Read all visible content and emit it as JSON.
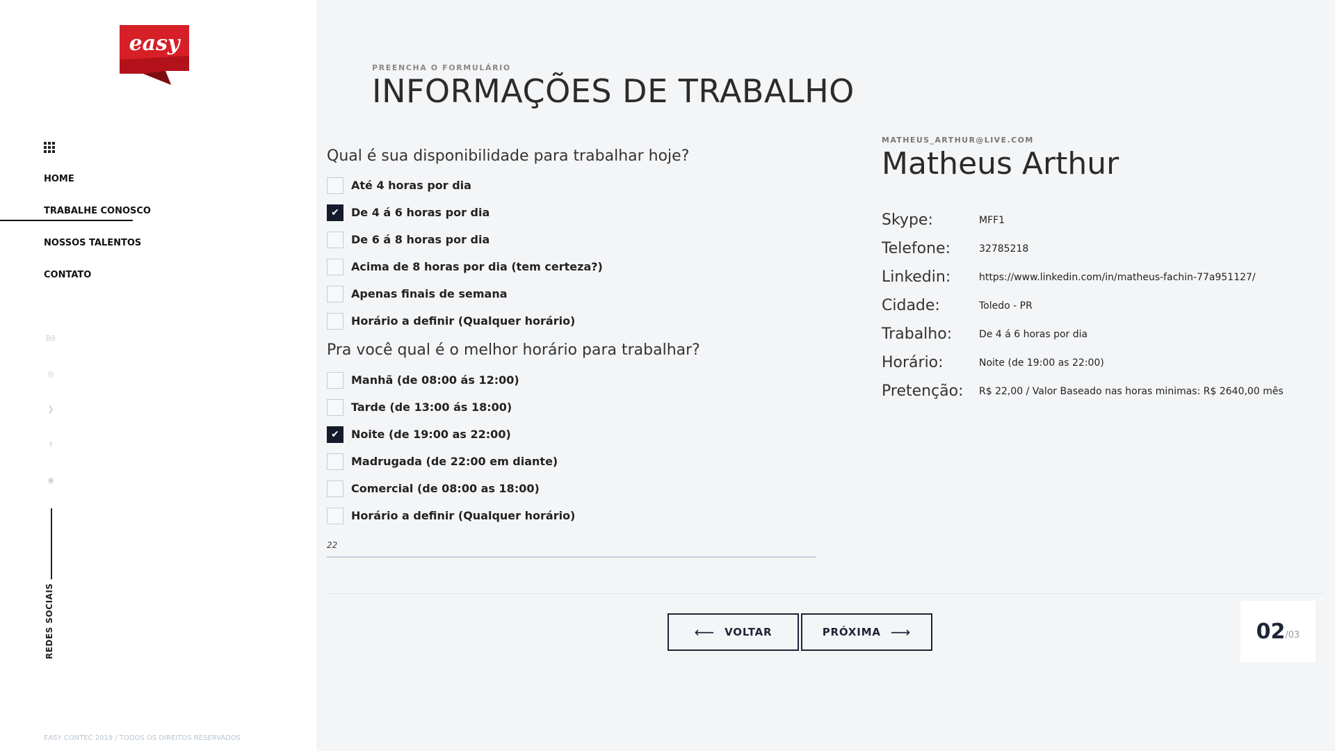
{
  "brand": {
    "logo_text": "easy",
    "logo_color": "#c9161f"
  },
  "nav": {
    "items": [
      {
        "label": "HOME"
      },
      {
        "label": "TRABALHE CONOSCO",
        "active": true
      },
      {
        "label": "NOSSOS TALENTOS"
      },
      {
        "label": "CONTATO"
      }
    ]
  },
  "social": {
    "icons": [
      "behance-icon",
      "dribbble-icon",
      "twitter-icon",
      "facebook-icon",
      "instagram-icon"
    ],
    "label": "REDES SOCIAIS"
  },
  "footer": {
    "text": "EASY CONTEC 2019 / TODOS OS DIREITOS RESERVADOS"
  },
  "header": {
    "pre_title": "PREENCHA O FORMULÁRIO",
    "title": "INFORMAÇÕES DE TRABALHO"
  },
  "form": {
    "q1": {
      "question": "Qual é sua disponibilidade para trabalhar hoje?",
      "options": [
        {
          "label": "Até 4 horas por dia",
          "checked": false
        },
        {
          "label": "De 4 á 6 horas por dia",
          "checked": true
        },
        {
          "label": "De 6 á 8 horas por dia",
          "checked": false
        },
        {
          "label": "Acima de 8 horas por dia (tem certeza?)",
          "checked": false
        },
        {
          "label": "Apenas finais de semana",
          "checked": false
        },
        {
          "label": "Horário a definir (Qualquer horário)",
          "checked": false
        }
      ]
    },
    "q2": {
      "question": "Pra você qual é o melhor horário para trabalhar?",
      "options": [
        {
          "label": "Manhã (de 08:00 ás 12:00)",
          "checked": false
        },
        {
          "label": "Tarde (de 13:00 ás 18:00)",
          "checked": false
        },
        {
          "label": "Noite (de 19:00 as 22:00)",
          "checked": true
        },
        {
          "label": "Madrugada (de 22:00 em diante)",
          "checked": false
        },
        {
          "label": "Comercial (de 08:00 as 18:00)",
          "checked": false
        },
        {
          "label": "Horário a definir (Qualquer horário)",
          "checked": false
        }
      ]
    },
    "input_value": "22"
  },
  "profile": {
    "email": "MATHEUS_ARTHUR@LIVE.COM",
    "name": "Matheus Arthur",
    "fields": [
      {
        "label": "Skype:",
        "value": "MFF1"
      },
      {
        "label": "Telefone:",
        "value": "32785218"
      },
      {
        "label": "Linkedin:",
        "value": "https://www.linkedin.com/in/matheus-fachin-77a951127/"
      },
      {
        "label": "Cidade:",
        "value": "Toledo - PR"
      },
      {
        "label": "Trabalho:",
        "value": "De 4 á 6 horas por dia"
      },
      {
        "label": "Horário:",
        "value": "Noite (de 19:00 as 22:00)"
      },
      {
        "label": "Pretenção:",
        "value": "R$ 22,00 / Valor Baseado nas horas minimas: R$ 2640,00 mês"
      }
    ]
  },
  "navigation": {
    "back_label": "VOLTAR",
    "next_label": "PRÓXIMA",
    "current_page": "02",
    "total_pages": "/03"
  },
  "colors": {
    "accent_dark": "#141b2b",
    "sidebar_bg": "#ffffff",
    "main_bg": "#f4f5f7"
  }
}
